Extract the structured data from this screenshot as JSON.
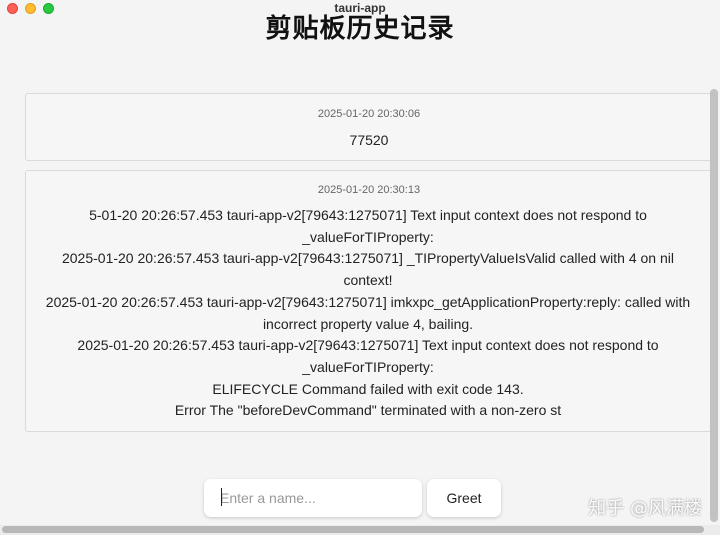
{
  "window": {
    "title": "tauri-app"
  },
  "page": {
    "title": "剪贴板历史记录"
  },
  "history": [
    {
      "timestamp": "2025-01-20 20:30:06",
      "content": "77520"
    },
    {
      "timestamp": "2025-01-20 20:30:13",
      "content": "5-01-20 20:26:57.453 tauri-app-v2[79643:1275071] Text input context does not respond to\n_valueForTIProperty:\n2025-01-20 20:26:57.453 tauri-app-v2[79643:1275071] _TIPropertyValueIsValid called with 4 on nil\ncontext!\n2025-01-20 20:26:57.453 tauri-app-v2[79643:1275071] imkxpc_getApplicationProperty:reply: called with\nincorrect property value 4, bailing.\n2025-01-20 20:26:57.453 tauri-app-v2[79643:1275071] Text input context does not respond to\n_valueForTIProperty:\nELIFECYCLE  Command failed with exit code 143.\nError The \"beforeDevCommand\" terminated with a non-zero st"
    }
  ],
  "form": {
    "name_placeholder": "Enter a name...",
    "greet_label": "Greet"
  },
  "watermark": "知乎 @风满楼",
  "colors": {
    "close": "#fe5f57",
    "minimize": "#febc2e",
    "maximize": "#28c840"
  }
}
